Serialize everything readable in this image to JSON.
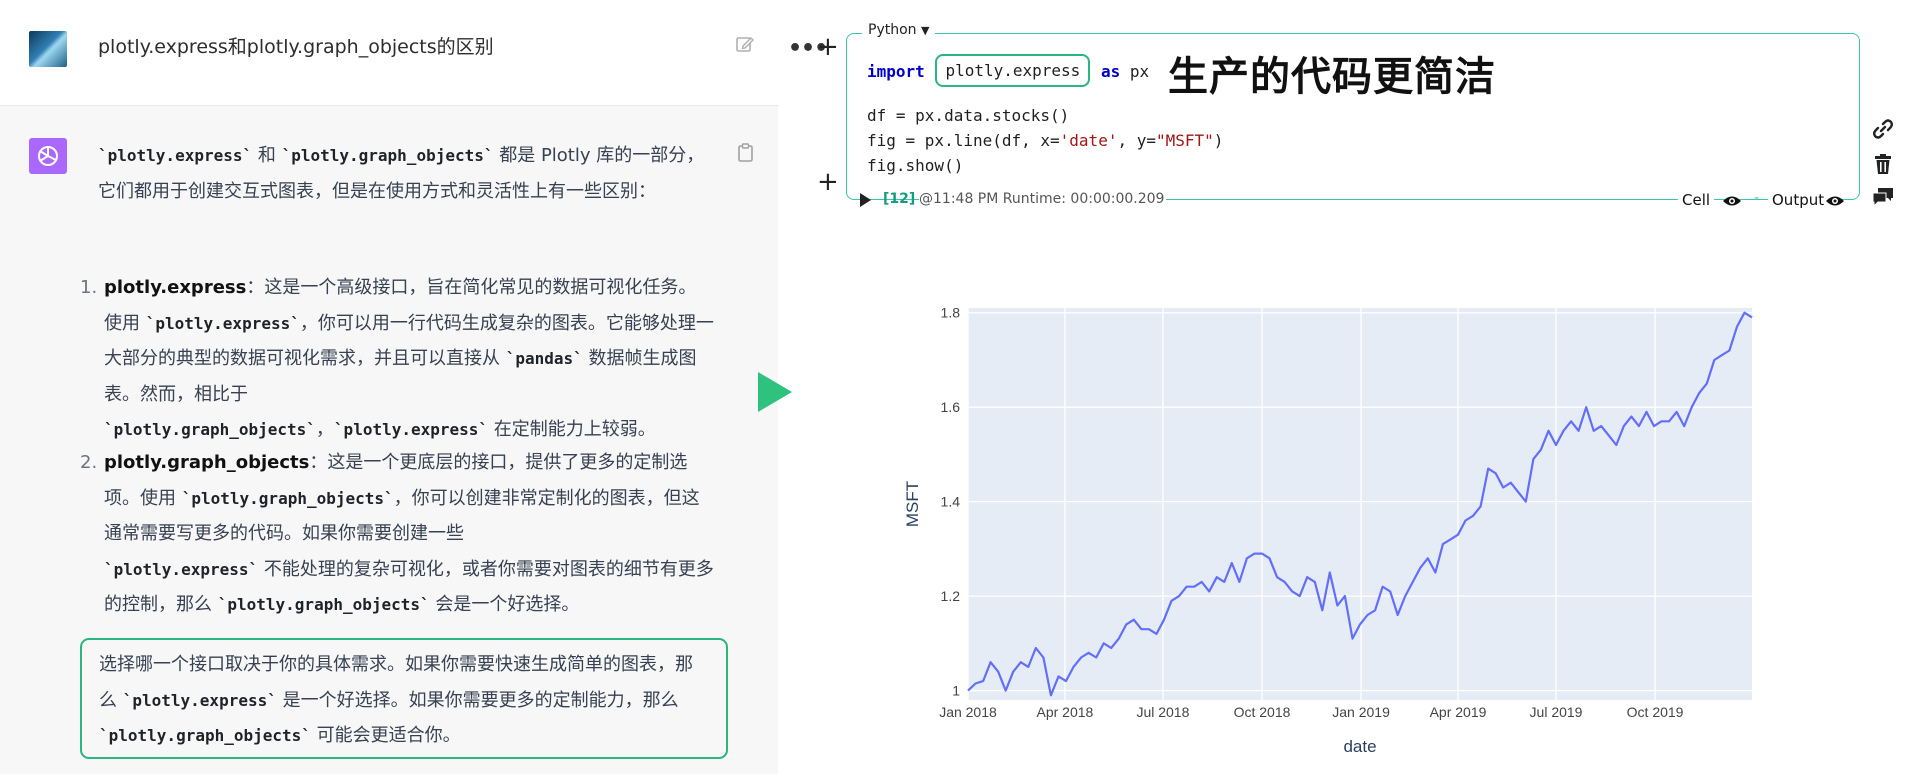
{
  "chat": {
    "title": "plotly.express和plotly.graph_objects的区别",
    "intro": {
      "code1": "`plotly.express`",
      "t1": " 和 ",
      "code2": "`plotly.graph_objects`",
      "t2": " 都是 Plotly 库的一部分，它们都用于创建交互式图表，但是在使用方式和灵活性上有一些区别："
    },
    "items": [
      {
        "num": "1.",
        "title": "plotly.express",
        "t1": "：这是一个高级接口，旨在简化常见的数据可视化任务。使用 ",
        "c1": "`plotly.express`",
        "t2": "，你可以用一行代码生成复杂的图表。它能够处理一大部分的典型的数据可视化需求，并且可以直接从 ",
        "c2": "`pandas`",
        "t3": " 数据帧生成图表。然而，相比于 ",
        "c3": "`plotly.graph_objects`",
        "t4": "，",
        "c4": "`plotly.express`",
        "t5": " 在定制能力上较弱。"
      },
      {
        "num": "2.",
        "title": "plotly.graph_objects",
        "t1": "：这是一个更底层的接口，提供了更多的定制选项。使用 ",
        "c1": "`plotly.graph_objects`",
        "t2": "，你可以创建非常定制化的图表，但这通常需要写更多的代码。如果你需要创建一些 ",
        "c2": "`plotly.express`",
        "t3": " 不能处理的复杂可视化，或者你需要对图表的细节有更多的控制，那么 ",
        "c3": "`plotly.graph_objects`",
        "t4": " 会是一个好选择。"
      }
    ],
    "summary": {
      "t1": "选择哪一个接口取决于你的具体需求。如果你需要快速生成简单的图表，那么 ",
      "c1": "`plotly.express`",
      "t2": " 是一个好选择。如果你需要更多的定制能力，那么 ",
      "c2": "`plotly.graph_objects`",
      "t3": " 可能会更适合你。"
    }
  },
  "notebook": {
    "language": "Python",
    "menu_glyph": "•••",
    "add_glyph": "+",
    "code": {
      "l1_kw": "import",
      "l1_mod": "plotly.express",
      "l1_as": "as",
      "l1_alias": "px",
      "l2": "df = px.data.stocks()",
      "l3_a": "fig = px.line(df, x=",
      "l3_s1": "'date'",
      "l3_b": ", y=",
      "l3_s2": "\"MSFT\"",
      "l3_c": ")",
      "l4": "fig.show()"
    },
    "annotation": "生产的代码更简洁",
    "run": {
      "count": "[12]",
      "info": "@11:48 PM Runtime: 00:00:00.209",
      "cell_label": "Cell",
      "dash": "-",
      "output_label": "Output"
    }
  },
  "icons": [
    "edit-icon",
    "copy-icon",
    "openai-logo-icon",
    "play-icon",
    "eye-icon",
    "link-icon",
    "trash-icon",
    "comment-icon",
    "chevron-down-icon"
  ],
  "colors": {
    "accent_green": "#2bb57f",
    "cell_border": "#3cc6a8",
    "line": "#636efa",
    "plot_bg": "#e5ecf6",
    "bot_avatar": "#ab68ff"
  },
  "chart_data": {
    "type": "line",
    "xlabel": "date",
    "ylabel": "MSFT",
    "x_tick_labels": [
      "Jan 2018",
      "Apr 2018",
      "Jul 2018",
      "Oct 2018",
      "Jan 2019",
      "Apr 2019",
      "Jul 2019",
      "Oct 2019"
    ],
    "y_tick_labels": [
      "1",
      "1.2",
      "1.4",
      "1.6",
      "1.8"
    ],
    "x_range": [
      "2018-01-01",
      "2019-12-30"
    ],
    "ylim": [
      0.98,
      1.81
    ],
    "grid": true,
    "series": [
      {
        "x": [
          "2018-01-01",
          "2018-01-08",
          "2018-01-15",
          "2018-01-22",
          "2018-01-29",
          "2018-02-05",
          "2018-02-12",
          "2018-02-19",
          "2018-02-26",
          "2018-03-05",
          "2018-03-12",
          "2018-03-19",
          "2018-03-26",
          "2018-04-02",
          "2018-04-09",
          "2018-04-16",
          "2018-04-23",
          "2018-04-30",
          "2018-05-07",
          "2018-05-14",
          "2018-05-21",
          "2018-05-28",
          "2018-06-04",
          "2018-06-11",
          "2018-06-18",
          "2018-06-25",
          "2018-07-02",
          "2018-07-09",
          "2018-07-16",
          "2018-07-23",
          "2018-07-30",
          "2018-08-06",
          "2018-08-13",
          "2018-08-20",
          "2018-08-27",
          "2018-09-03",
          "2018-09-10",
          "2018-09-17",
          "2018-09-24",
          "2018-10-01",
          "2018-10-08",
          "2018-10-15",
          "2018-10-22",
          "2018-10-29",
          "2018-11-05",
          "2018-11-12",
          "2018-11-19",
          "2018-11-26",
          "2018-12-03",
          "2018-12-10",
          "2018-12-17",
          "2018-12-24",
          "2018-12-31",
          "2019-01-07",
          "2019-01-14",
          "2019-01-21",
          "2019-01-28",
          "2019-02-04",
          "2019-02-11",
          "2019-02-18",
          "2019-02-25",
          "2019-03-04",
          "2019-03-11",
          "2019-03-18",
          "2019-03-25",
          "2019-04-01",
          "2019-04-08",
          "2019-04-15",
          "2019-04-22",
          "2019-04-29",
          "2019-05-06",
          "2019-05-13",
          "2019-05-20",
          "2019-05-27",
          "2019-06-03",
          "2019-06-10",
          "2019-06-17",
          "2019-06-24",
          "2019-07-01",
          "2019-07-08",
          "2019-07-15",
          "2019-07-22",
          "2019-07-29",
          "2019-08-05",
          "2019-08-12",
          "2019-08-19",
          "2019-08-26",
          "2019-09-02",
          "2019-09-09",
          "2019-09-16",
          "2019-09-23",
          "2019-09-30",
          "2019-10-07",
          "2019-10-14",
          "2019-10-21",
          "2019-10-28",
          "2019-11-04",
          "2019-11-11",
          "2019-11-18",
          "2019-11-25",
          "2019-12-02",
          "2019-12-09",
          "2019-12-16",
          "2019-12-23",
          "2019-12-30"
        ],
        "values": [
          1.0,
          1.015,
          1.02,
          1.06,
          1.04,
          1.0,
          1.04,
          1.06,
          1.05,
          1.09,
          1.07,
          0.99,
          1.03,
          1.02,
          1.05,
          1.07,
          1.08,
          1.07,
          1.1,
          1.09,
          1.11,
          1.14,
          1.15,
          1.13,
          1.13,
          1.12,
          1.15,
          1.19,
          1.2,
          1.22,
          1.22,
          1.23,
          1.21,
          1.24,
          1.23,
          1.27,
          1.23,
          1.28,
          1.29,
          1.29,
          1.28,
          1.24,
          1.23,
          1.21,
          1.2,
          1.24,
          1.23,
          1.17,
          1.25,
          1.18,
          1.2,
          1.11,
          1.14,
          1.16,
          1.17,
          1.22,
          1.21,
          1.16,
          1.2,
          1.23,
          1.26,
          1.28,
          1.25,
          1.31,
          1.32,
          1.33,
          1.36,
          1.37,
          1.39,
          1.47,
          1.46,
          1.43,
          1.44,
          1.42,
          1.4,
          1.49,
          1.51,
          1.55,
          1.52,
          1.55,
          1.57,
          1.55,
          1.6,
          1.55,
          1.56,
          1.54,
          1.52,
          1.56,
          1.58,
          1.56,
          1.59,
          1.56,
          1.57,
          1.57,
          1.59,
          1.56,
          1.6,
          1.63,
          1.65,
          1.7,
          1.71,
          1.72,
          1.77,
          1.8,
          1.79
        ]
      }
    ]
  }
}
